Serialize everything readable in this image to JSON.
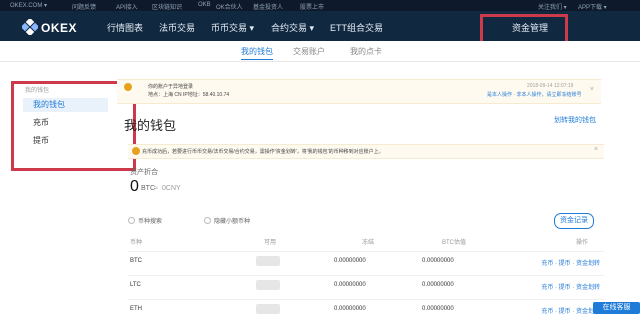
{
  "topbar": {
    "items": [
      "OKEX.COM ▾",
      "问题反馈",
      "API接入",
      "区块链知识",
      "OKB",
      "OK合伙人",
      "基金投资人",
      "股票上市"
    ],
    "right": [
      "关注我们 ▾",
      "APP下载 ▾"
    ]
  },
  "brand": {
    "name": "OKEX"
  },
  "nav": {
    "items": [
      "行情图表",
      "法币交易",
      "币币交易 ▾",
      "合约交易 ▾",
      "ETT组合交易"
    ],
    "funds": "资金管理"
  },
  "subtabs": [
    "我的钱包",
    "交易账户",
    "我的点卡"
  ],
  "sidebar": {
    "header": "我的钱包",
    "items": [
      "我的钱包",
      "充币",
      "提币"
    ]
  },
  "notice": {
    "line1": "你的账户于异地登录",
    "line2": "地点：上海 CN    IP地址：58.40.10.74",
    "time": "2018-09-14  12:07:19",
    "action": "是本人操作 · 非本人操作，请立即冻结账号"
  },
  "page": {
    "title": "我的钱包",
    "transfer_link": "划转我的钱包",
    "deposit_notice": "充币成功后，若要进行币币交易/法币交易/合约交易，需操作'资金划转'，将'我的钱包'的币种移到对应账户上。",
    "balance_label": "资产折合",
    "balance_value": "0",
    "balance_unit": "BTC",
    "balance_sep": "≈",
    "balance_cny": "0CNY"
  },
  "controls": {
    "search": "币种搜索",
    "hide_small": "隐藏小额币种",
    "records": "资金记录"
  },
  "table": {
    "headers": [
      "币种",
      "可用",
      "冻结",
      "BTC估值",
      "操作"
    ],
    "rows": [
      {
        "coin": "BTC",
        "frozen": "0.00000000",
        "btc": "0.00000000",
        "actions": "充币 · 提币 · 资金划转"
      },
      {
        "coin": "LTC",
        "frozen": "0.00000000",
        "btc": "0.00000000",
        "actions": "充币 · 提币 · 资金划转"
      },
      {
        "coin": "ETH",
        "frozen": "0.00000000",
        "btc": "0.00000000",
        "actions": "充币 · 提币 · 资金划转"
      }
    ]
  },
  "widget": {
    "label": "在线客服"
  },
  "colors": {
    "nav_bg": "#102840",
    "accent": "#1f7bd8",
    "highlight": "#cf3a4b",
    "warning": "#e6a21d"
  }
}
